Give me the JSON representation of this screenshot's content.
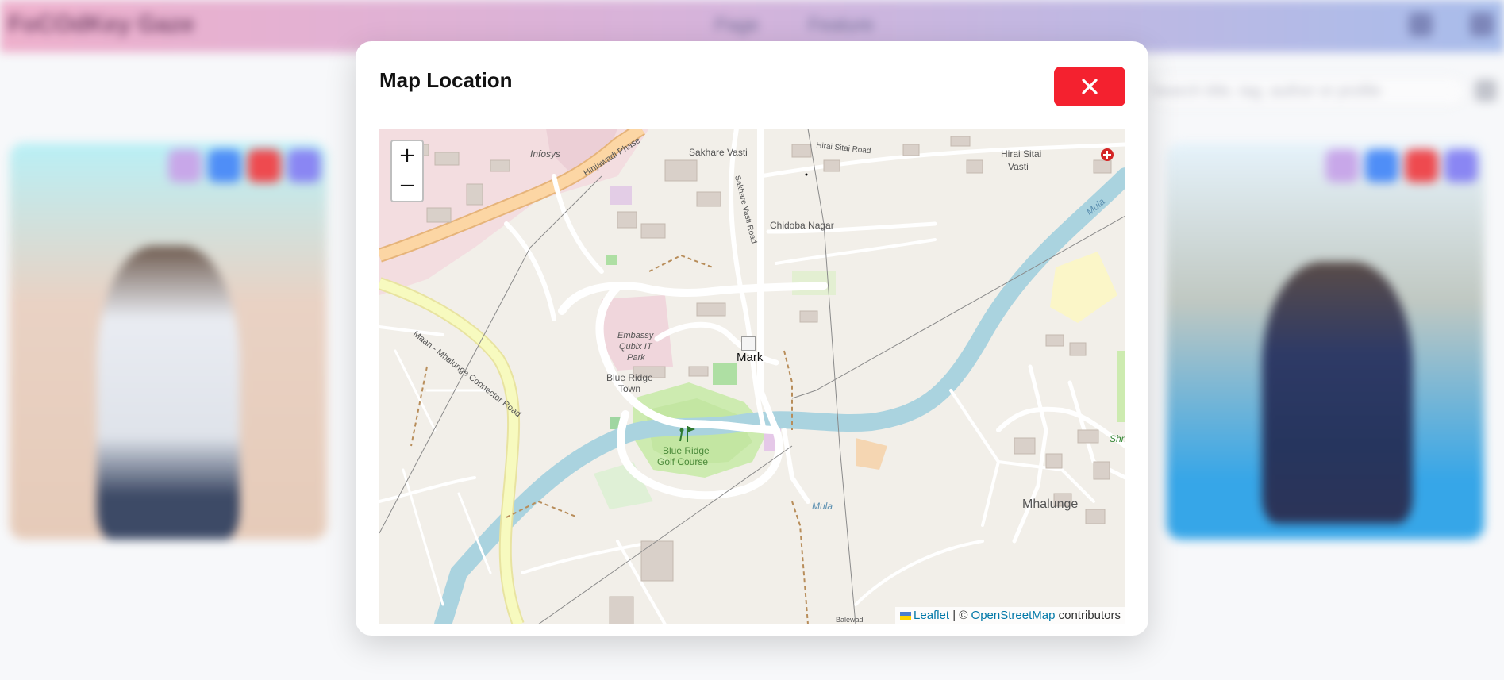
{
  "background": {
    "brand": "FoCOdKey Gaze",
    "nav": [
      "Page",
      "Feature"
    ],
    "search_placeholder": "Search title, tag, author or profile"
  },
  "modal": {
    "title": "Map Location",
    "close_icon": "close-icon"
  },
  "map": {
    "zoom_in": "+",
    "zoom_out": "−",
    "marker_alt": "Mark",
    "attribution": {
      "leaflet": "Leaflet",
      "separator": "| ©",
      "osm": "OpenStreetMap",
      "suffix": "contributors"
    },
    "labels": {
      "infosys": "Infosys",
      "hinjawadi_phase": "Hinjawadi Phase",
      "sakhare_vasti": "Sakhare Vasti",
      "hirai_sitai_road": "Hirai Sitai Road",
      "hirai_sitai_vasti_1": "Hirai Sitai",
      "hirai_sitai_vasti_2": "Vasti",
      "sakhare_vasti_road": "Sakhare Vasti Road",
      "chidoba_nagar": "Chidoba Nagar",
      "embassy_1": "Embassy",
      "embassy_2": "Qubix IT",
      "embassy_3": "Park",
      "blue_ridge_town_1": "Blue Ridge",
      "blue_ridge_town_2": "Town",
      "maan_road": "Maan - Mhalunge Connector Road",
      "golf_1": "Blue Ridge",
      "golf_2": "Golf Course",
      "mula_1": "Mula",
      "mula_2": "Mula",
      "mhalunge": "Mhalunge",
      "shri": "Shri",
      "balewadi": "Balewadi"
    }
  },
  "colors": {
    "close_button": "#f4212f",
    "river": "#aad3df",
    "major_road": "#f7fabf",
    "trunk_road": "#fcd6a4",
    "land": "#f2efe9",
    "link": "#0078a8"
  }
}
